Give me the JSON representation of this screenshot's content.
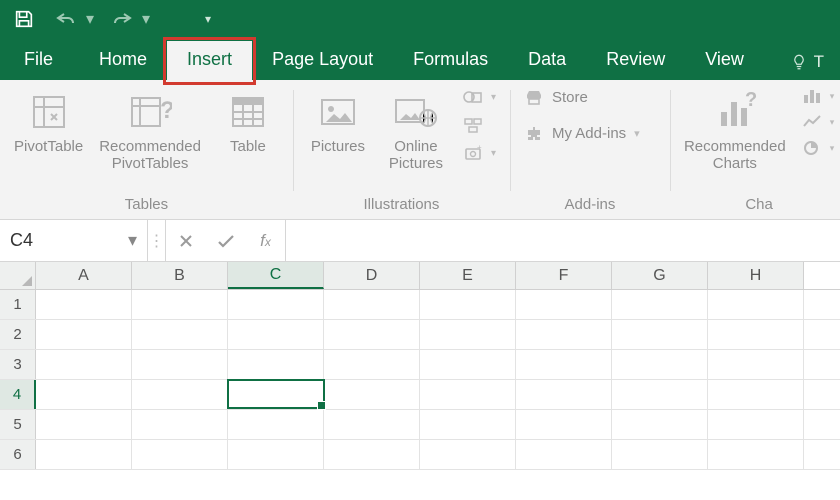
{
  "qat": {
    "save": "save-icon",
    "undo": "undo-icon",
    "redo": "redo-icon",
    "customize": "customize-qat-icon"
  },
  "tabs": {
    "file": "File",
    "home": "Home",
    "insert": "Insert",
    "page_layout": "Page Layout",
    "formulas": "Formulas",
    "data": "Data",
    "review": "Review",
    "view": "View",
    "tellme_prefix": "T",
    "active": "insert",
    "highlighted": "insert"
  },
  "ribbon": {
    "tables": {
      "label": "Tables",
      "pivot": "PivotTable",
      "recommended_pivot": "Recommended\nPivotTables",
      "table": "Table"
    },
    "illustrations": {
      "label": "Illustrations",
      "pictures": "Pictures",
      "online_pictures": "Online\nPictures"
    },
    "addins": {
      "label": "Add-ins",
      "store": "Store",
      "my_addins": "My Add-ins"
    },
    "charts": {
      "label": "Cha",
      "recommended_charts": "Recommended\nCharts"
    }
  },
  "namebox": {
    "value": "C4"
  },
  "formula": {
    "value": ""
  },
  "grid": {
    "columns": [
      "A",
      "B",
      "C",
      "D",
      "E",
      "F",
      "G",
      "H"
    ],
    "rows": [
      "1",
      "2",
      "3",
      "4",
      "5",
      "6"
    ],
    "active": {
      "col": "C",
      "row": "4"
    }
  },
  "colors": {
    "brand": "#0f7044",
    "highlight": "#d23a2f"
  }
}
